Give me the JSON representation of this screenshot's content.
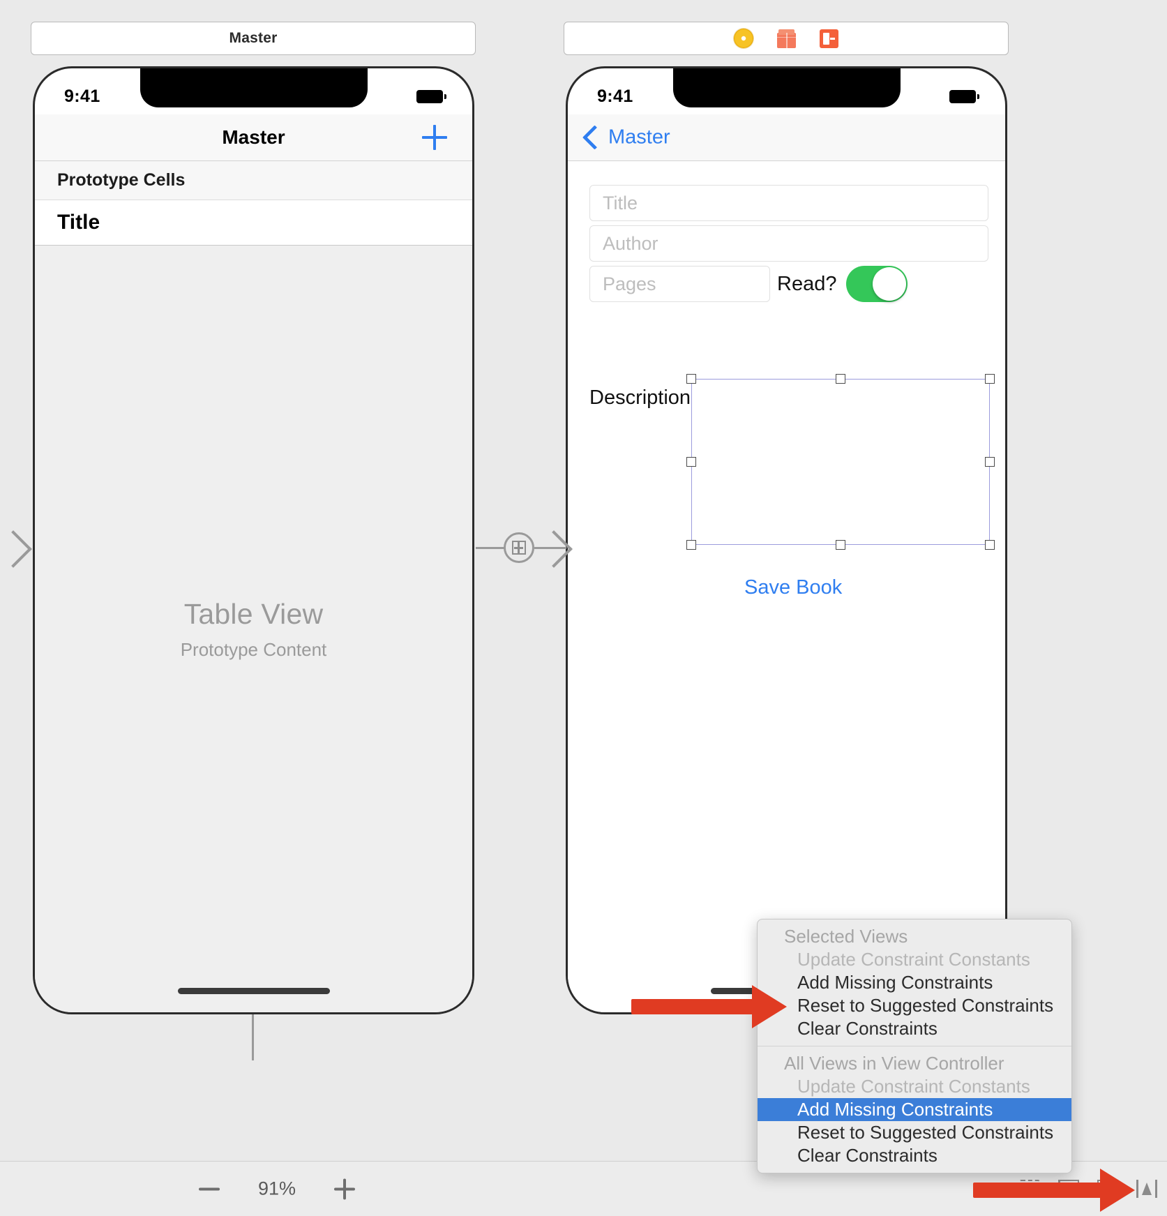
{
  "canvas": {
    "zoom_level": "91%",
    "zoom_minus_label": "−",
    "zoom_plus_label": "+"
  },
  "master_scene": {
    "dock_title": "Master",
    "status_time": "9:41",
    "nav_title": "Master",
    "add_button": "+",
    "section_header": "Prototype Cells",
    "prototype_cell_label": "Title",
    "placeholder_title": "Table View",
    "placeholder_subtitle": "Prototype Content"
  },
  "detail_scene": {
    "dock_icons": [
      "view-controller-icon",
      "first-responder-icon",
      "exit-icon"
    ],
    "status_time": "9:41",
    "back_button": "Master",
    "fields": [
      {
        "name": "title-field",
        "placeholder": "Title"
      },
      {
        "name": "author-field",
        "placeholder": "Author"
      },
      {
        "name": "pages-field",
        "placeholder": "Pages"
      }
    ],
    "read_label": "Read?",
    "read_switch_on": true,
    "read_switch_color": "#34c759",
    "description_label": "Description",
    "save_button": "Save Book"
  },
  "context_menu": {
    "sections": [
      {
        "group": "Selected Views",
        "items": [
          {
            "label": "Update Constraint Constants",
            "state": "disabled"
          },
          {
            "label": "Add Missing Constraints",
            "state": "normal"
          },
          {
            "label": "Reset to Suggested Constraints",
            "state": "normal"
          },
          {
            "label": "Clear Constraints",
            "state": "normal"
          }
        ]
      },
      {
        "group": "All Views in View Controller",
        "items": [
          {
            "label": "Update Constraint Constants",
            "state": "disabled"
          },
          {
            "label": "Add Missing Constraints",
            "state": "selected"
          },
          {
            "label": "Reset to Suggested Constraints",
            "state": "normal"
          },
          {
            "label": "Clear Constraints",
            "state": "normal"
          }
        ]
      }
    ],
    "highlight_color": "#3b7ed8"
  },
  "annotations": {
    "arrow_color": "#e03b22",
    "arrow_menu_target": "Add Missing Constraints",
    "arrow_toolbar_target": "resolve-auto-layout-issues-button"
  }
}
